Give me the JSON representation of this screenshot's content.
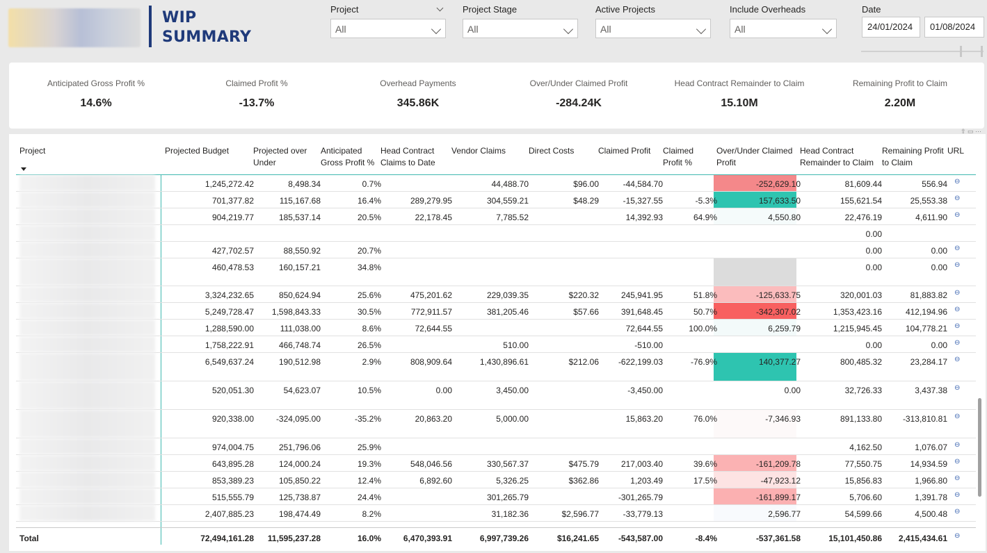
{
  "header": {
    "title_line1": "WIP",
    "title_line2": "SUMMARY",
    "slicers": [
      {
        "label": "Project",
        "value": "All"
      },
      {
        "label": "Project Stage",
        "value": "All"
      },
      {
        "label": "Active Projects",
        "value": "All"
      },
      {
        "label": "Include Overheads",
        "value": "All"
      }
    ],
    "date": {
      "label": "Date",
      "start": "24/01/2024",
      "end": "01/08/2024"
    }
  },
  "kpis": [
    {
      "label": "Anticipated Gross Profit %",
      "value": "14.6%"
    },
    {
      "label": "Claimed Profit %",
      "value": "-13.7%"
    },
    {
      "label": "Overhead Payments",
      "value": "345.86K"
    },
    {
      "label": "Over/Under Claimed Profit",
      "value": "-284.24K"
    },
    {
      "label": "Head Contract Remainder to Claim",
      "value": "15.10M"
    },
    {
      "label": "Remaining Profit to Claim",
      "value": "2.20M"
    }
  ],
  "table": {
    "columns": [
      "Project",
      "Projected Budget",
      "Projected over Under",
      "Anticipated Gross Profit %",
      "Head Contract Claims to Date",
      "Vendor Claims",
      "Direct Costs",
      "Claimed Profit",
      "Claimed Profit %",
      "Over/Under Claimed Profit",
      "Head Contract Remainder to Claim",
      "Remaining Profit to Claim",
      "URL"
    ],
    "rows": [
      [
        "1,245,272.42",
        "8,498.34",
        "0.7%",
        "",
        "44,488.70",
        "$96.00",
        "-44,584.70",
        "",
        "-252,629.10",
        "81,609.44",
        "556.94"
      ],
      [
        "701,377.82",
        "115,167.68",
        "16.4%",
        "289,279.95",
        "304,559.21",
        "$48.29",
        "-15,327.55",
        "-5.3%",
        "157,633.50",
        "155,621.54",
        "25,553.38"
      ],
      [
        "904,219.77",
        "185,537.14",
        "20.5%",
        "22,178.45",
        "7,785.52",
        "",
        "14,392.93",
        "64.9%",
        "4,550.80",
        "22,476.19",
        "4,611.90"
      ],
      [
        "",
        "",
        "",
        "",
        "",
        "",
        "",
        "",
        "",
        "0.00",
        ""
      ],
      [
        "427,702.57",
        "88,550.92",
        "20.7%",
        "",
        "",
        "",
        "",
        "",
        "",
        "0.00",
        "0.00"
      ],
      [
        "460,478.53",
        "160,157.21",
        "34.8%",
        "",
        "",
        "",
        "",
        "",
        "",
        "0.00",
        "0.00"
      ],
      [
        "3,324,232.65",
        "850,624.94",
        "25.6%",
        "475,201.62",
        "229,039.35",
        "$220.32",
        "245,941.95",
        "51.8%",
        "-125,633.75",
        "320,001.03",
        "81,883.82"
      ],
      [
        "5,249,728.47",
        "1,598,843.33",
        "30.5%",
        "772,911.57",
        "381,205.46",
        "$57.66",
        "391,648.45",
        "50.7%",
        "-342,307.02",
        "1,353,423.16",
        "412,194.96"
      ],
      [
        "1,288,590.00",
        "111,038.00",
        "8.6%",
        "72,644.55",
        "",
        "",
        "72,644.55",
        "100.0%",
        "6,259.79",
        "1,215,945.45",
        "104,778.21"
      ],
      [
        "1,758,222.91",
        "466,748.74",
        "26.5%",
        "",
        "510.00",
        "",
        "-510.00",
        "",
        "",
        "0.00",
        "0.00"
      ],
      [
        "6,549,637.24",
        "190,512.98",
        "2.9%",
        "808,909.64",
        "1,430,896.61",
        "$212.06",
        "-622,199.03",
        "-76.9%",
        "140,377.27",
        "800,485.32",
        "23,284.17"
      ],
      [
        "520,051.30",
        "54,623.07",
        "10.5%",
        "0.00",
        "3,450.00",
        "",
        "-3,450.00",
        "",
        "0.00",
        "32,726.33",
        "3,437.38"
      ],
      [
        "920,338.00",
        "-324,095.00",
        "-35.2%",
        "20,863.20",
        "5,000.00",
        "",
        "15,863.20",
        "76.0%",
        "-7,346.93",
        "891,133.80",
        "-313,810.81"
      ],
      [
        "974,004.75",
        "251,796.06",
        "25.9%",
        "",
        "",
        "",
        "",
        "",
        "",
        "4,162.50",
        "1,076.07"
      ],
      [
        "643,895.28",
        "124,000.24",
        "19.3%",
        "548,046.56",
        "330,567.37",
        "$475.79",
        "217,003.40",
        "39.6%",
        "-161,209.78",
        "77,550.75",
        "14,934.59"
      ],
      [
        "853,389.23",
        "105,850.22",
        "12.4%",
        "6,892.60",
        "5,326.25",
        "$362.86",
        "1,203.49",
        "17.5%",
        "-47,923.12",
        "15,856.83",
        "1,966.80"
      ],
      [
        "515,555.79",
        "125,738.87",
        "24.4%",
        "",
        "301,265.79",
        "",
        "-301,265.79",
        "",
        "-161,899.17",
        "5,706.60",
        "1,391.78"
      ],
      [
        "2,407,885.23",
        "198,474.49",
        "8.2%",
        "",
        "31,182.36",
        "$2,596.77",
        "-33,779.13",
        "",
        "2,596.77",
        "54,599.66",
        "4,500.48"
      ]
    ],
    "total": [
      "Total",
      "72,494,161.28",
      "11,595,237.28",
      "16.0%",
      "6,470,393.91",
      "6,997,739.26",
      "$16,241.65",
      "-543,587.00",
      "-8.4%",
      "-537,361.58",
      "15,101,450.86",
      "2,415,434.61"
    ],
    "highlight_colors": [
      "#f4888a",
      "#2ec4b0",
      "#f5fbfb",
      "",
      "",
      "#dcdcdc",
      "#fbbcbd",
      "#f86060",
      "#f3fafa",
      "",
      "#2ec4b0",
      "",
      "#fdf9f9",
      "",
      "#fbb2b3",
      "#fde3e3",
      "#fbb0b1",
      "#f8fafd"
    ]
  }
}
